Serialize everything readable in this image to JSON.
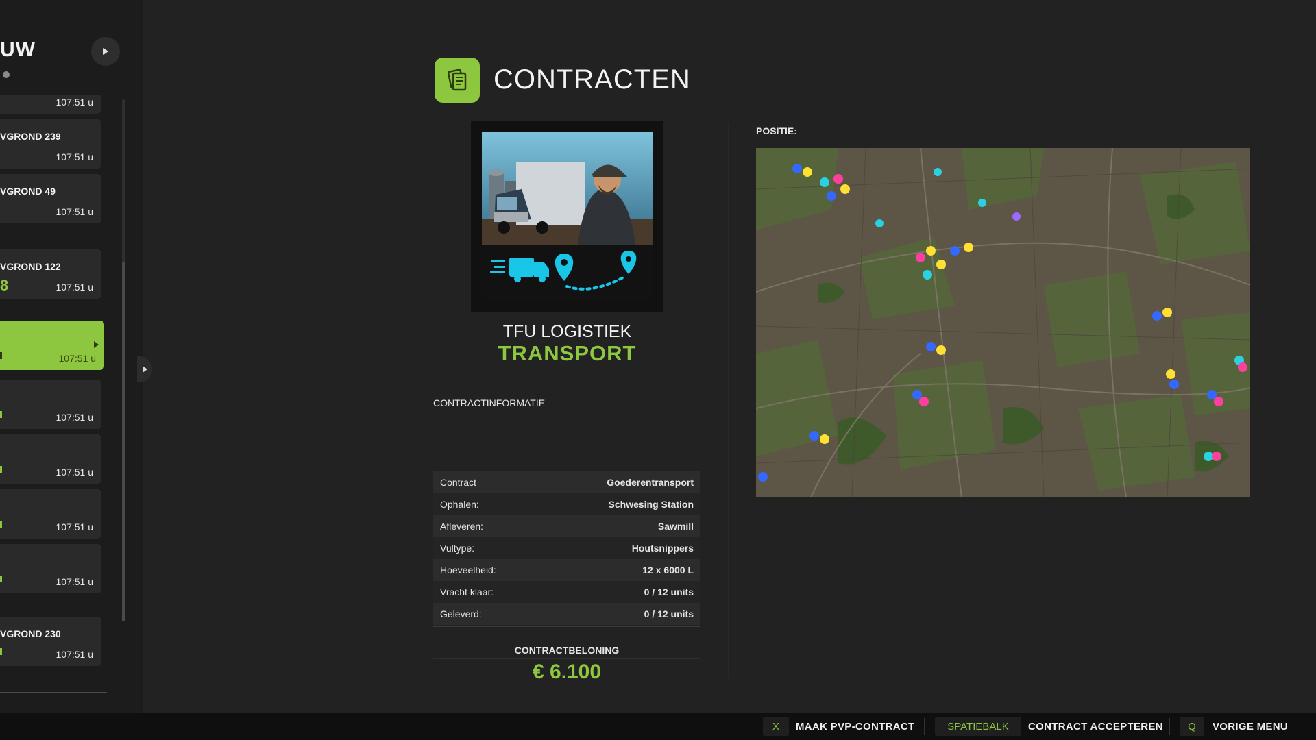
{
  "sidebar": {
    "title": "UW",
    "items": [
      {
        "name": "",
        "time": "107:51 u"
      },
      {
        "name": "VGROND 239",
        "time": "107:51 u"
      },
      {
        "name": "VGROND 49",
        "time": "107:51 u"
      },
      {
        "name": "VGROND 122",
        "accent": "8",
        "time": "107:51 u"
      },
      {
        "name": "",
        "time": "107:51 u",
        "selected": true
      },
      {
        "name": "",
        "time": "107:51 u"
      },
      {
        "name": "",
        "time": "107:51 u"
      },
      {
        "name": "",
        "time": "107:51 u"
      },
      {
        "name": "",
        "time": "107:51 u"
      },
      {
        "name": "VGROND 230",
        "time": "107:51 u"
      }
    ]
  },
  "header": {
    "title": "CONTRACTEN",
    "icon": "contract-document-icon"
  },
  "contract": {
    "company": "TFU LOGISTIEK",
    "type": "TRANSPORT",
    "info_label": "CONTRACTINFORMATIE",
    "details": [
      {
        "label": "Contract",
        "value": "Goederentransport"
      },
      {
        "label": "Ophalen:",
        "value": "Schwesing Station"
      },
      {
        "label": "Afleveren:",
        "value": "Sawmill"
      },
      {
        "label": "Vultype:",
        "value": "Houtsnippers"
      },
      {
        "label": "Hoeveelheid:",
        "value": "12 x 6000 L"
      },
      {
        "label": "Vracht klaar:",
        "value": "0 / 12 units"
      },
      {
        "label": "Geleverd:",
        "value": "0 / 12 units"
      }
    ],
    "reward_label": "CONTRACTBELONING",
    "reward_value": "€ 6.100"
  },
  "map": {
    "label": "POSITIE:"
  },
  "bottom_bar": {
    "actions": [
      {
        "key": "X",
        "label": "MAAK PVP-CONTRACT"
      },
      {
        "key": "SPATIEBALK",
        "label": "CONTRACT ACCEPTEREN"
      },
      {
        "key": "Q",
        "label": "VORIGE MENU"
      }
    ]
  },
  "colors": {
    "accent": "#8dc63f",
    "background": "#222222",
    "sidebar": "#1c1c1c",
    "map_ground": "#5d5545"
  }
}
